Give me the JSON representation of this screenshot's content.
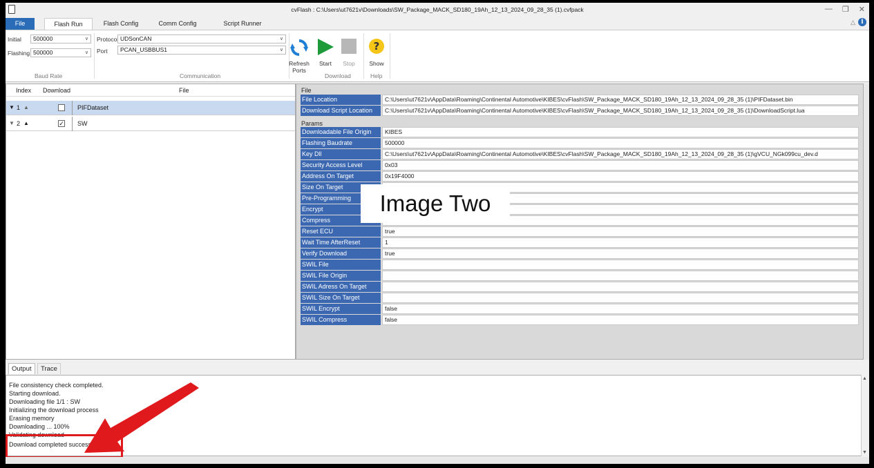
{
  "window": {
    "title": "cvFlash : C:\\Users\\ut7621v\\Downloads\\SW_Package_MACK_SD180_19Ah_12_13_2024_09_28_35 (1).cvfpack"
  },
  "ribbon_tabs": [
    "File",
    "Flash Run",
    "Flash Config",
    "Comm Config",
    "Script Runner"
  ],
  "baud_rate": {
    "initial_label": "Initial",
    "initial_value": "500000",
    "flashing_label": "Flashing",
    "flashing_value": "500000",
    "group_label": "Baud Rate"
  },
  "communication": {
    "protocol_label": "Protocol",
    "protocol_value": "UDSonCAN",
    "port_label": "Port",
    "port_value": "PCAN_USBBUS1",
    "group_label": "Communication"
  },
  "buttons": {
    "refresh": "Refresh Ports",
    "start": "Start",
    "stop": "Stop",
    "show": "Show",
    "download_group": "Download",
    "help_group": "Help"
  },
  "file_list": {
    "headers": [
      "Index",
      "Download",
      "File"
    ],
    "rows": [
      {
        "index": "1",
        "checked": false,
        "file": "PIFDataset"
      },
      {
        "index": "2",
        "checked": true,
        "file": "SW"
      }
    ]
  },
  "file_section": {
    "title": "File",
    "rows": [
      {
        "key": "File Location",
        "value": "C:\\Users\\ut7621v\\AppData\\Roaming\\Continental Automotive\\KIBES\\cvFlash\\SW_Package_MACK_SD180_19Ah_12_13_2024_09_28_35 (1)\\PIFDataset.bin"
      },
      {
        "key": "Download Script Location",
        "value": "C:\\Users\\ut7621v\\AppData\\Roaming\\Continental Automotive\\KIBES\\cvFlash\\SW_Package_MACK_SD180_19Ah_12_13_2024_09_28_35 (1)\\DownloadScript.lua"
      }
    ]
  },
  "params_section": {
    "title": "Params",
    "rows": [
      {
        "key": "Downloadable File Origin",
        "value": "KIBES"
      },
      {
        "key": "Flashing Baudrate",
        "value": "500000"
      },
      {
        "key": "Key Dll",
        "value": "C:\\Users\\ut7621v\\AppData\\Roaming\\Continental Automotive\\KIBES\\cvFlash\\SW_Package_MACK_SD180_19Ah_12_13_2024_09_28_35 (1)\\gVCU_NGk099cu_dev.d"
      },
      {
        "key": "Security Access Level",
        "value": "0x03"
      },
      {
        "key": "Address On Target",
        "value": "0x19F4000"
      },
      {
        "key": "Size On Target",
        "value": ""
      },
      {
        "key": "Pre-Programming",
        "value": ""
      },
      {
        "key": "Encrypt",
        "value": ""
      },
      {
        "key": "Compress",
        "value": ""
      },
      {
        "key": "Reset ECU",
        "value": "true"
      },
      {
        "key": "Wait Time AfterReset",
        "value": "1"
      },
      {
        "key": "Verify Download",
        "value": "true"
      },
      {
        "key": "SWIL File",
        "value": ""
      },
      {
        "key": "SWIL File Origin",
        "value": ""
      },
      {
        "key": "SWIL Adress On Target",
        "value": ""
      },
      {
        "key": "SWIL Size On Target",
        "value": ""
      },
      {
        "key": "SWIL Encrypt",
        "value": "false"
      },
      {
        "key": "SWIL Compress",
        "value": "false"
      }
    ]
  },
  "overlay_text": "Image Two",
  "output": {
    "tabs": [
      "Output",
      "Trace"
    ],
    "lines": [
      "File consistency check completed.",
      "Starting download.",
      "Downloading file 1/1 : SW",
      "Initializing the download process",
      "Erasing memory",
      "Downloading ... 100%",
      "Validating download",
      "Download completed successfully"
    ]
  },
  "colors": {
    "accent": "#2b6cb8",
    "key_bg": "#3b68b1",
    "arrow": "#e0191d"
  }
}
